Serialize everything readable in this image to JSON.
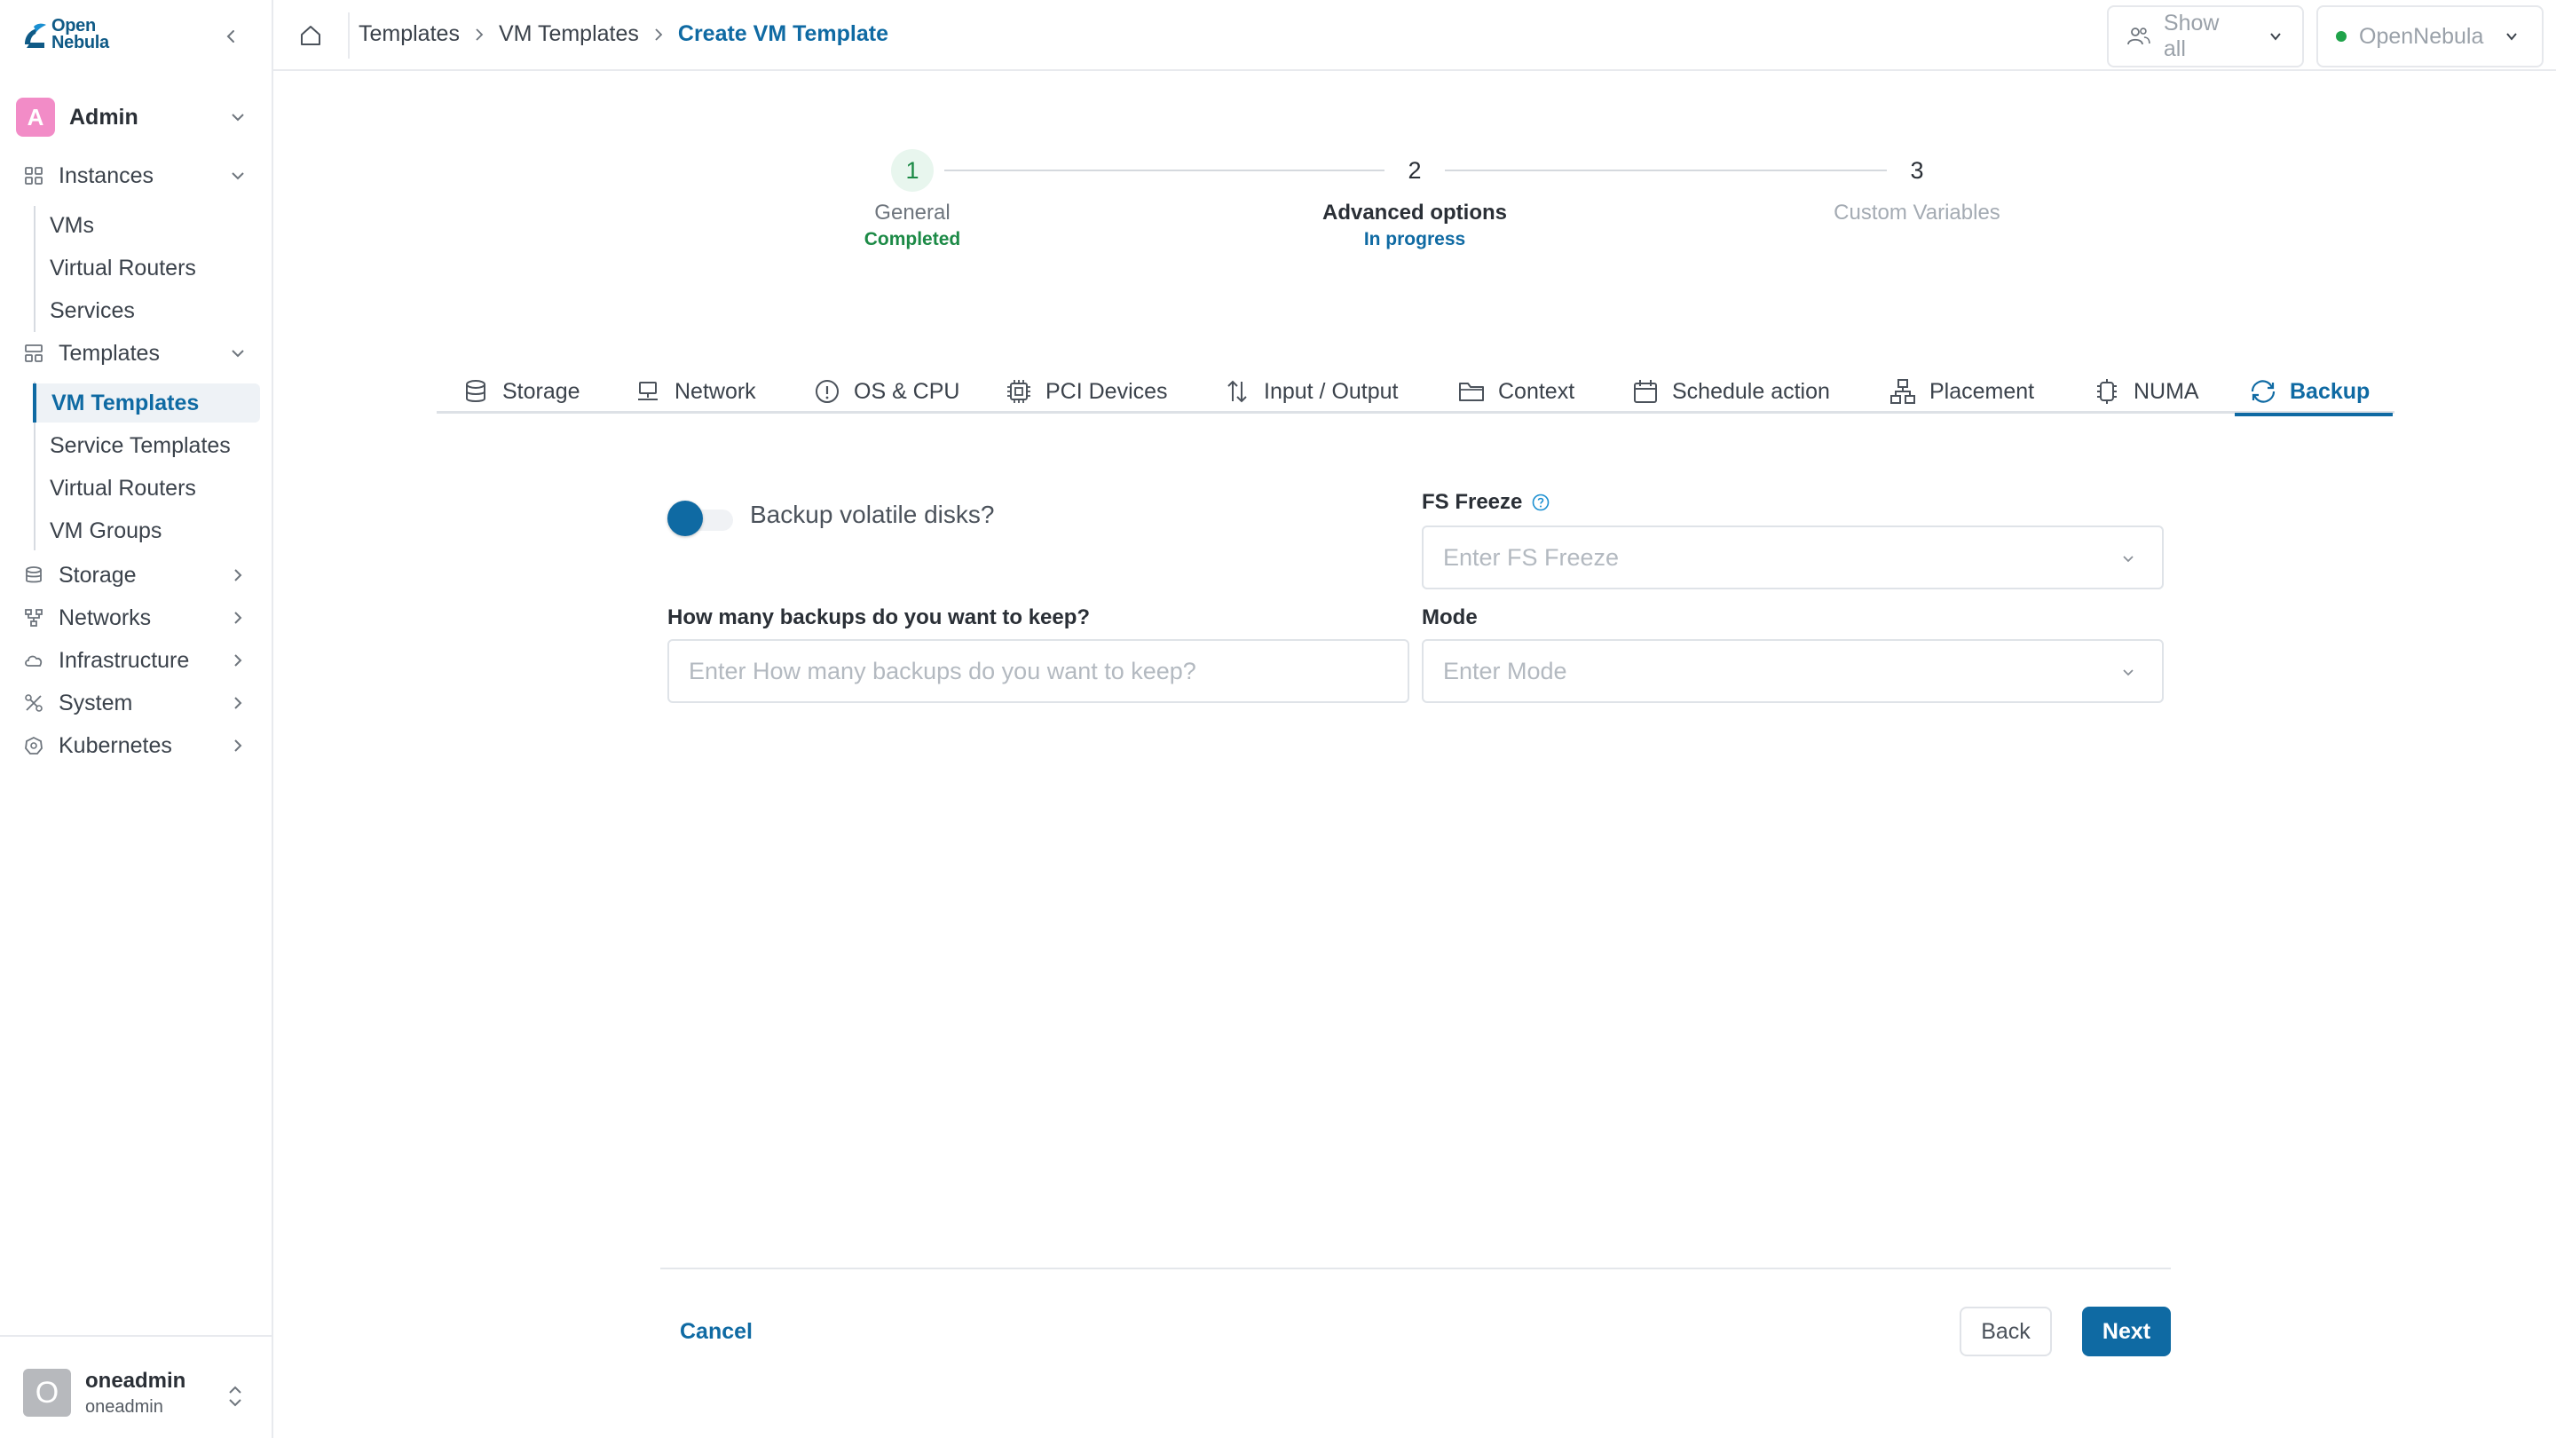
{
  "brand": {
    "logo_line1": "Open",
    "logo_line2": "Nebula",
    "accent": "#0f6aa3"
  },
  "sidebar": {
    "admin_initial": "A",
    "admin_label": "Admin",
    "instances": {
      "label": "Instances",
      "items": [
        "VMs",
        "Virtual Routers",
        "Services"
      ]
    },
    "templates": {
      "label": "Templates",
      "items": [
        "VM Templates",
        "Service Templates",
        "Virtual Routers",
        "VM Groups"
      ]
    },
    "sections": [
      "Storage",
      "Networks",
      "Infrastructure",
      "System",
      "Kubernetes"
    ],
    "user": {
      "initial": "O",
      "name": "oneadmin",
      "sub": "oneadmin"
    }
  },
  "header": {
    "breadcrumb": [
      "Templates",
      "VM Templates",
      "Create VM Template"
    ],
    "group_filter": "Show all",
    "cluster": "OpenNebula"
  },
  "stepper": {
    "steps": [
      {
        "number": "1",
        "title": "General",
        "status": "Completed",
        "status_color": "#1c8a46"
      },
      {
        "number": "2",
        "title": "Advanced options",
        "status": "In progress",
        "status_color": "#0f6aa3"
      },
      {
        "number": "3",
        "title": "Custom Variables",
        "status": ""
      }
    ]
  },
  "tabs": [
    "Storage",
    "Network",
    "OS & CPU",
    "PCI Devices",
    "Input / Output",
    "Context",
    "Schedule action",
    "Placement",
    "NUMA",
    "Backup"
  ],
  "form": {
    "toggle_label": "Backup volatile disks?",
    "fs_freeze_label": "FS Freeze",
    "fs_freeze_placeholder": "Enter FS Freeze",
    "keep_label": "How many backups do you want to keep?",
    "keep_placeholder": "Enter How many backups do you want to keep?",
    "mode_label": "Mode",
    "mode_placeholder": "Enter Mode"
  },
  "footer": {
    "cancel": "Cancel",
    "back": "Back",
    "next": "Next"
  }
}
